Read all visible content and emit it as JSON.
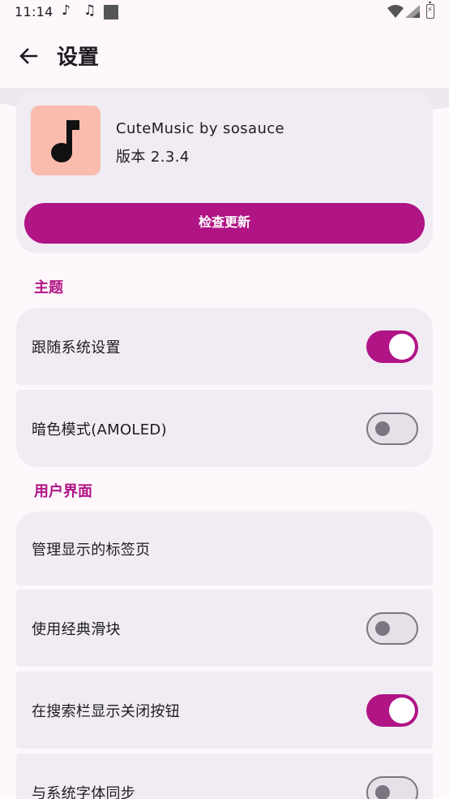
{
  "status_bar": {
    "time": "11:14",
    "icons": [
      "music-note-icon",
      "music-note-icon",
      "stop-square-icon",
      "wifi-icon",
      "signal-icon",
      "battery-icon"
    ]
  },
  "app_bar": {
    "title": "设置",
    "back_icon": "arrow-back-icon"
  },
  "about": {
    "app_name": "CuteMusic by sosauce",
    "version": "版本 2.3.4",
    "update_button": "检查更新",
    "icon": "music-note-icon"
  },
  "sections": {
    "theme": {
      "title": "主题",
      "items": [
        {
          "label": "跟随系统设置",
          "toggle": true
        },
        {
          "label": "暗色模式(AMOLED)",
          "toggle": false
        }
      ]
    },
    "ui": {
      "title": "用户界面",
      "items": [
        {
          "label": "管理显示的标签页"
        },
        {
          "label": "使用经典滑块",
          "toggle": false
        },
        {
          "label": "在搜索栏显示关闭按钮",
          "toggle": true
        },
        {
          "label": "与系统字体同步",
          "toggle": false
        }
      ]
    }
  },
  "colors": {
    "accent": "#b01485",
    "card": "#f1ecf4",
    "background": "#fef7fb"
  }
}
